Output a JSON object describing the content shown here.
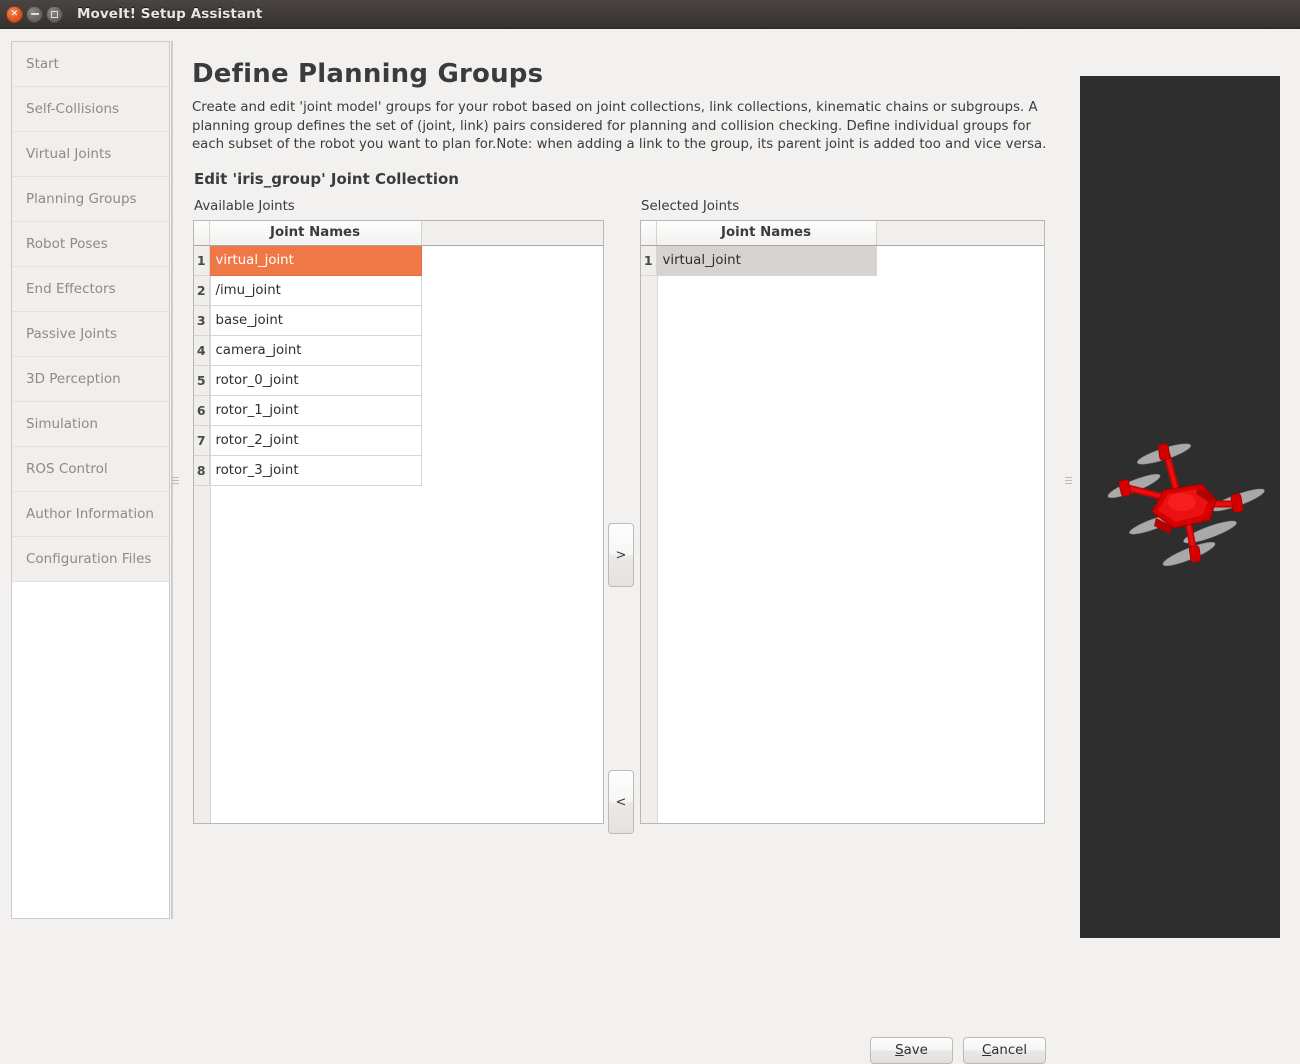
{
  "window": {
    "title": "MoveIt! Setup Assistant",
    "close_icon": "close-icon",
    "minimize_icon": "minimize-icon",
    "maximize_icon": "maximize-icon"
  },
  "sidebar": {
    "items": [
      {
        "label": "Start"
      },
      {
        "label": "Self-Collisions"
      },
      {
        "label": "Virtual Joints"
      },
      {
        "label": "Planning Groups"
      },
      {
        "label": "Robot Poses"
      },
      {
        "label": "End Effectors"
      },
      {
        "label": "Passive Joints"
      },
      {
        "label": "3D Perception"
      },
      {
        "label": "Simulation"
      },
      {
        "label": "ROS Control"
      },
      {
        "label": "Author Information"
      },
      {
        "label": "Configuration Files"
      }
    ]
  },
  "main": {
    "page_title": "Define Planning Groups",
    "description": "Create and edit 'joint model' groups for your robot based on joint collections, link collections, kinematic chains or subgroups. A planning group defines the set of (joint, link) pairs considered for planning and collision checking. Define individual groups for each subset of the robot you want to plan for.Note: when adding a link to the group, its parent joint is added too and vice versa.",
    "section_title": "Edit 'iris_group' Joint Collection",
    "available": {
      "label": "Available Joints",
      "column_header": "Joint Names",
      "rows": [
        {
          "index": "1",
          "name": "virtual_joint",
          "state": "selected-active"
        },
        {
          "index": "2",
          "name": "/imu_joint",
          "state": "normal"
        },
        {
          "index": "3",
          "name": "base_joint",
          "state": "normal"
        },
        {
          "index": "4",
          "name": "camera_joint",
          "state": "normal"
        },
        {
          "index": "5",
          "name": "rotor_0_joint",
          "state": "normal"
        },
        {
          "index": "6",
          "name": "rotor_1_joint",
          "state": "normal"
        },
        {
          "index": "7",
          "name": "rotor_2_joint",
          "state": "normal"
        },
        {
          "index": "8",
          "name": "rotor_3_joint",
          "state": "normal"
        }
      ]
    },
    "selected": {
      "label": "Selected Joints",
      "column_header": "Joint Names",
      "rows": [
        {
          "index": "1",
          "name": "virtual_joint",
          "state": "selected-inactive"
        }
      ]
    },
    "transfer": {
      "add_label": ">",
      "remove_label": "<"
    },
    "footer": {
      "save_label": "Save",
      "save_mnemonic": "S",
      "cancel_label": "Cancel",
      "cancel_mnemonic": "C"
    }
  },
  "view3d": {
    "robot_name": "iris quadrotor",
    "background_color": "#2e2e2e",
    "robot_color": "#e00000",
    "propeller_color": "#a8a8a8"
  },
  "colors": {
    "selection_orange": "#f07746",
    "selection_grey": "#d6d3d0",
    "window_bg": "#f2f1f0",
    "titlebar": "#3d3835"
  }
}
